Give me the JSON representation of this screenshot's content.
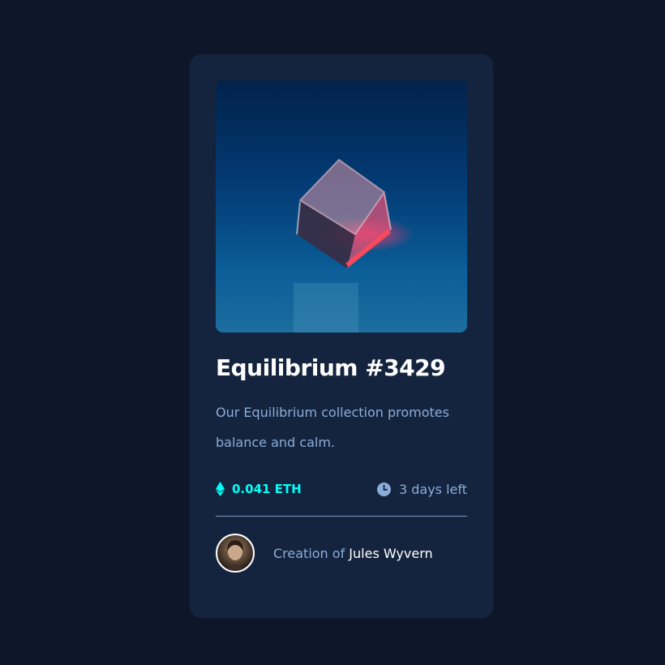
{
  "card": {
    "title": "Equilibrium #3429",
    "description": "Our Equilibrium collection promotes balance and calm.",
    "price": "0.041 ETH",
    "time_left": "3 days left",
    "creator_prefix": "Creation of",
    "creator_name": "Jules Wyvern"
  },
  "icons": {
    "price": "ethereum-icon",
    "time": "clock-icon",
    "avatar": "avatar"
  },
  "colors": {
    "page_bg": "#0e1729",
    "card_bg": "#15243e",
    "accent": "#00fff8",
    "muted": "#8bacd9",
    "white": "#ffffff"
  }
}
